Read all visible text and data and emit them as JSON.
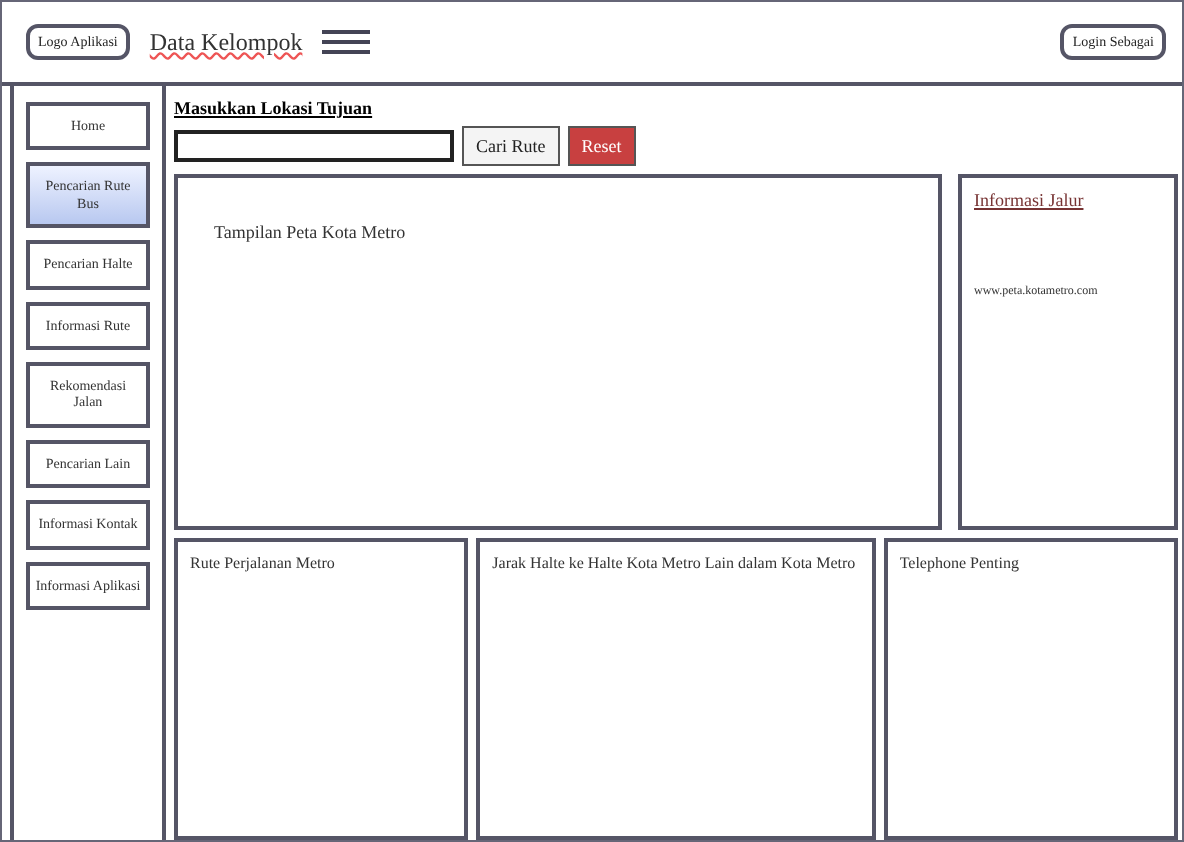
{
  "header": {
    "logo": "Logo Aplikasi",
    "title": "Data Kelompok",
    "account": "Login Sebagai"
  },
  "sidebar": {
    "items": [
      {
        "label": "Home",
        "selected": false
      },
      {
        "label": "Pencarian Rute Bus",
        "selected": true
      },
      {
        "label": "Pencarian Halte",
        "selected": false
      },
      {
        "label": "Informasi Rute",
        "selected": false
      },
      {
        "label": "Rekomendasi Jalan",
        "selected": false
      },
      {
        "label": "Pencarian Lain",
        "selected": false
      },
      {
        "label": "Informasi Kontak",
        "selected": false
      },
      {
        "label": "Informasi Aplikasi",
        "selected": false
      }
    ]
  },
  "search": {
    "label": "Masukkan Lokasi Tujuan",
    "button": "Cari Rute",
    "reset": "Reset"
  },
  "map": {
    "caption": "Tampilan Peta Kota Metro"
  },
  "info": {
    "title": "Informasi Jalur",
    "link": "www.peta.kotametro.com"
  },
  "panels": [
    {
      "title": "Rute Perjalanan Metro"
    },
    {
      "title": "Jarak Halte ke Halte Kota Metro Lain dalam Kota Metro"
    },
    {
      "title": "Telephone Penting"
    }
  ]
}
